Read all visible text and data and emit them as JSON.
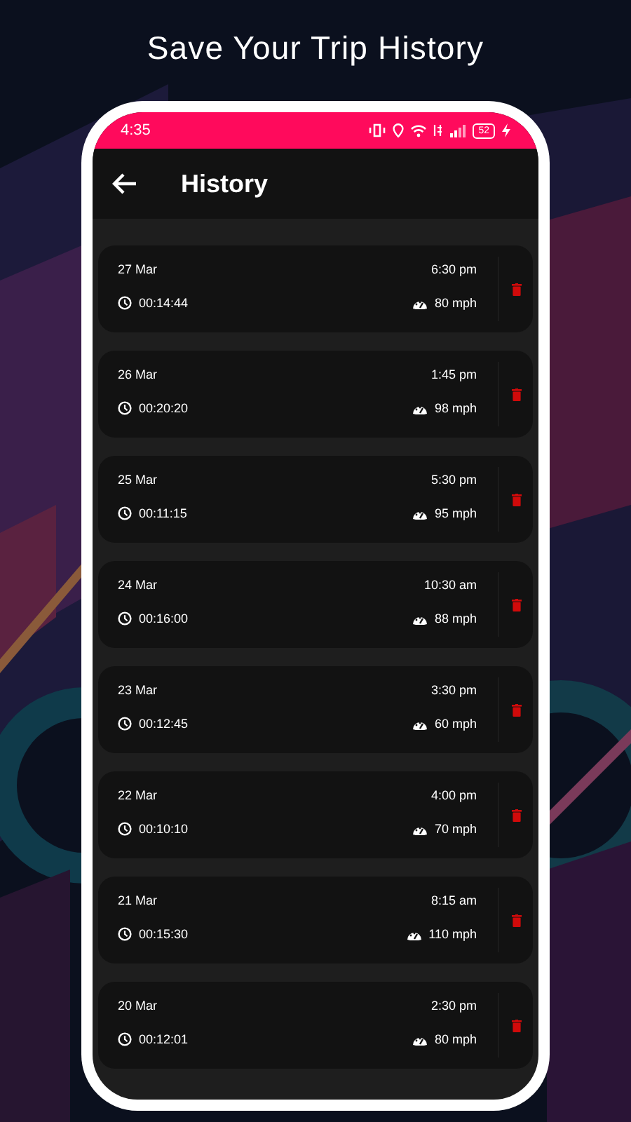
{
  "headline": "Save Your Trip History",
  "status_bar": {
    "time": "4:35",
    "battery": "52"
  },
  "app_bar": {
    "title": "History"
  },
  "trips": [
    {
      "date": "27 Mar",
      "time": "6:30 pm",
      "duration": "00:14:44",
      "speed": "80 mph"
    },
    {
      "date": "26 Mar",
      "time": "1:45 pm",
      "duration": "00:20:20",
      "speed": "98 mph"
    },
    {
      "date": "25 Mar",
      "time": "5:30 pm",
      "duration": "00:11:15",
      "speed": "95 mph"
    },
    {
      "date": "24 Mar",
      "time": "10:30 am",
      "duration": "00:16:00",
      "speed": "88 mph"
    },
    {
      "date": "23 Mar",
      "time": "3:30 pm",
      "duration": "00:12:45",
      "speed": "60 mph"
    },
    {
      "date": "22 Mar",
      "time": "4:00 pm",
      "duration": "00:10:10",
      "speed": "70 mph"
    },
    {
      "date": "21 Mar",
      "time": "8:15 am",
      "duration": "00:15:30",
      "speed": "110 mph"
    },
    {
      "date": "20 Mar",
      "time": "2:30 pm",
      "duration": "00:12:01",
      "speed": "80 mph"
    }
  ]
}
